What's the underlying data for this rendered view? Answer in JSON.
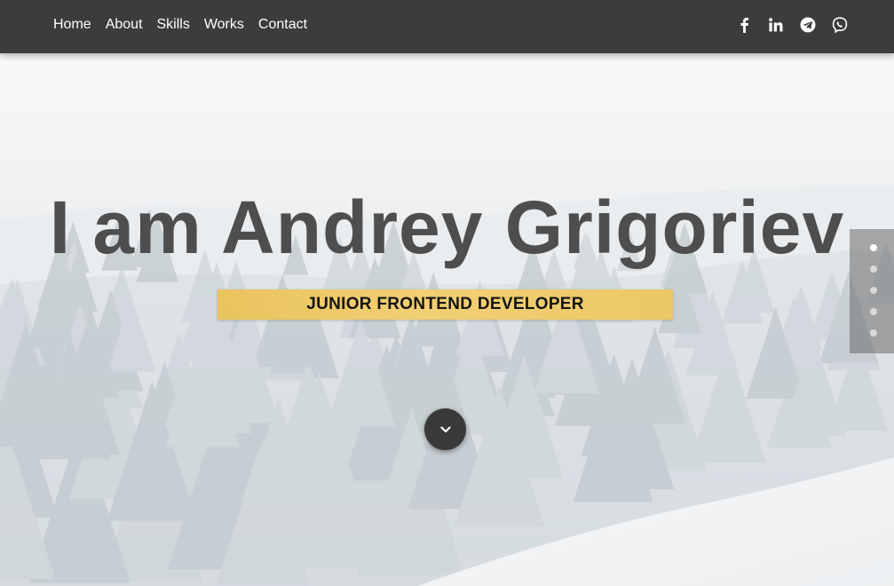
{
  "nav": {
    "items": [
      "Home",
      "About",
      "Skills",
      "Works",
      "Contact"
    ]
  },
  "socials": {
    "icons": [
      "facebook-icon",
      "linkedin-icon",
      "telegram-icon",
      "viber-icon"
    ]
  },
  "hero": {
    "headline": "I am Andrey Grigoriev",
    "subtitle": "JUNIOR FRONTEND DEVELOPER",
    "scroll_icon": "chevron-down-icon"
  },
  "pager": {
    "count": 5,
    "active_index": 0
  },
  "colors": {
    "topbar": "#3c3c3c",
    "headline": "#4e4e4e",
    "subtitle_bg": "#ecc865",
    "scroll_button": "#3a3a3a"
  }
}
